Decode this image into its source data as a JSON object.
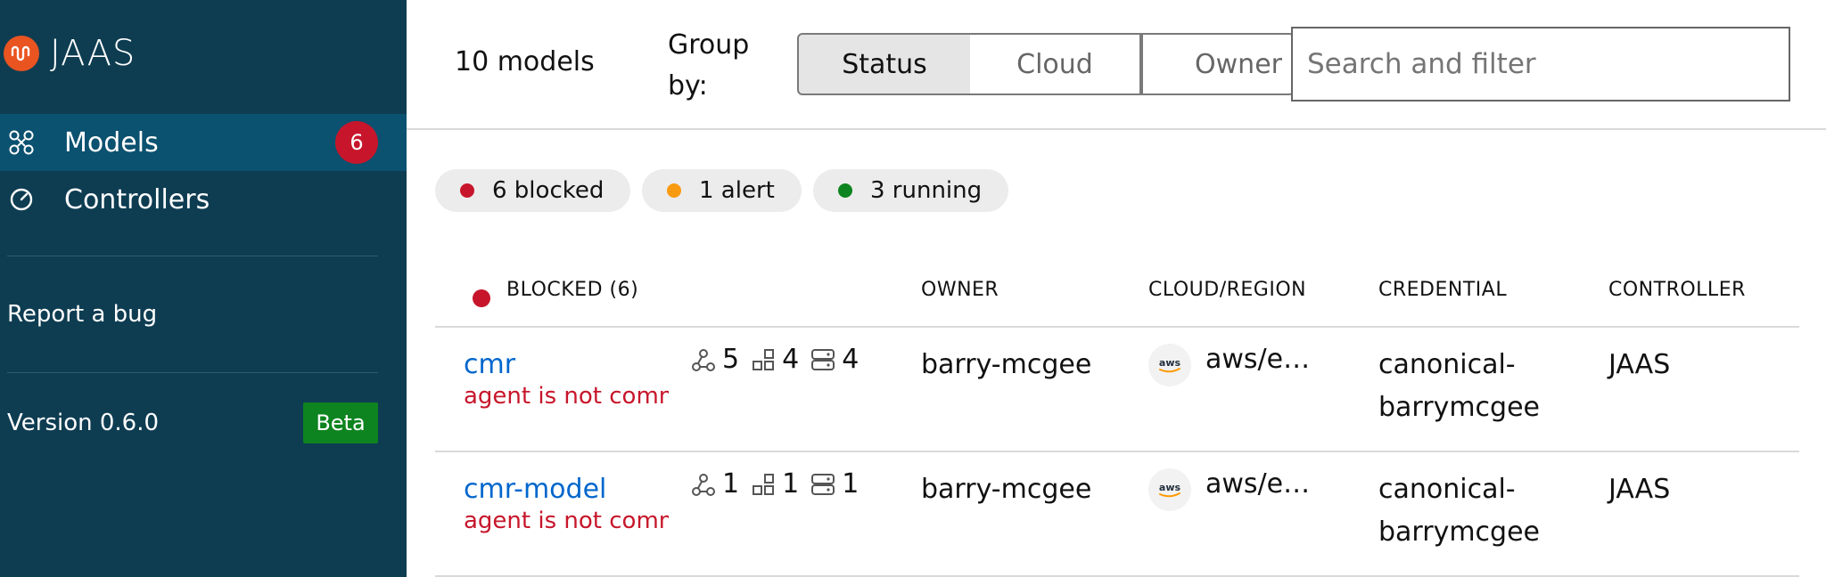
{
  "app": {
    "title": "JAAS"
  },
  "sidebar": {
    "items": [
      {
        "label": "Models",
        "badge": "6"
      },
      {
        "label": "Controllers"
      }
    ],
    "report_bug": "Report a bug",
    "version": "Version 0.6.0",
    "beta": "Beta"
  },
  "header": {
    "model_count": "10 models",
    "group_by_label": "Group by:",
    "group_options": [
      "Status",
      "Cloud",
      "Owner"
    ],
    "selected_group": "Status",
    "search_placeholder": "Search and filter"
  },
  "status_chips": [
    {
      "label": "6 blocked",
      "color": "#c7162b"
    },
    {
      "label": "1 alert",
      "color": "#f99b11"
    },
    {
      "label": "3 running",
      "color": "#0e8420"
    }
  ],
  "table": {
    "group_title": "BLOCKED (6)",
    "columns": [
      "OWNER",
      "CLOUD/REGION",
      "CREDENTIAL",
      "CONTROLLER"
    ],
    "rows": [
      {
        "name": "cmr",
        "message": "agent is not communicating with the server",
        "apps": "5",
        "units": "4",
        "machines": "4",
        "owner": "barry-mcgee",
        "cloud_icon": "aws",
        "region": "aws/e…",
        "credential_line1": "canonical-",
        "credential_line2": "barrymcgee",
        "controller": "JAAS"
      },
      {
        "name": "cmr-model",
        "message": "agent is not communicating with the server",
        "apps": "1",
        "units": "1",
        "machines": "1",
        "owner": "barry-mcgee",
        "cloud_icon": "aws",
        "region": "aws/e…",
        "credential_line1": "canonical-",
        "credential_line2": "barrymcgee",
        "controller": "JAAS"
      }
    ]
  },
  "colors": {
    "sidebar_bg": "#0e3d52",
    "active_nav": "#0b5170",
    "link": "#0066cc",
    "error": "#c7162b",
    "brand": "#e95420"
  }
}
